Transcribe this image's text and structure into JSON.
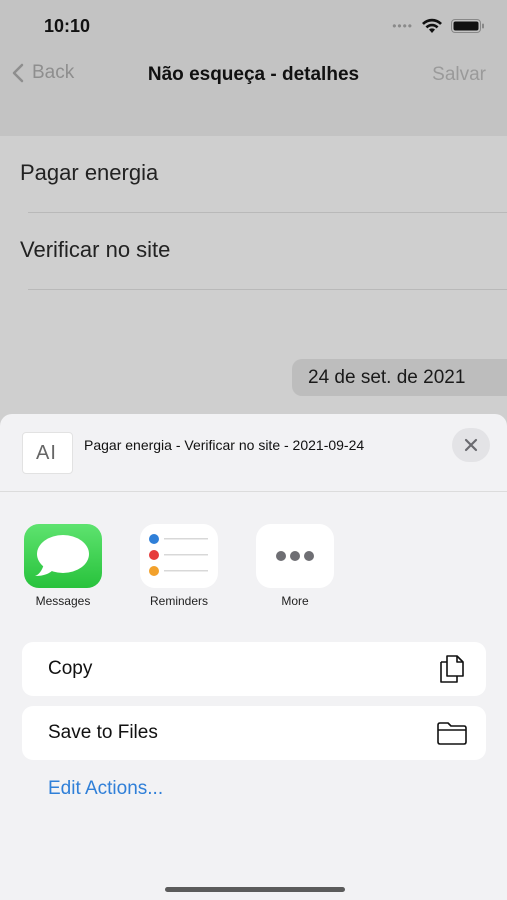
{
  "status_bar": {
    "time": "10:10"
  },
  "nav": {
    "back_label": "Back",
    "title": "Não esqueça - detalhes",
    "save_label": "Salvar"
  },
  "list": {
    "items": [
      {
        "text": "Pagar energia"
      },
      {
        "text": "Verificar no site"
      }
    ]
  },
  "date_label": "24 de set. de 2021",
  "share_sheet": {
    "preview_glyph": "AI",
    "preview_text": "Pagar energia -  Verificar no site - 2021-09-24",
    "apps": [
      {
        "label": "Messages",
        "icon": "messages-icon",
        "color": "#34c759"
      },
      {
        "label": "Reminders",
        "icon": "reminders-icon",
        "color": "#ffffff"
      },
      {
        "label": "More",
        "icon": "more-icon",
        "color": "#ffffff"
      }
    ],
    "actions": [
      {
        "label": "Copy",
        "icon": "copy-icon"
      },
      {
        "label": "Save to Files",
        "icon": "folder-icon"
      }
    ],
    "edit_actions_label": "Edit Actions...",
    "accent_color": "#2f7fd8"
  }
}
